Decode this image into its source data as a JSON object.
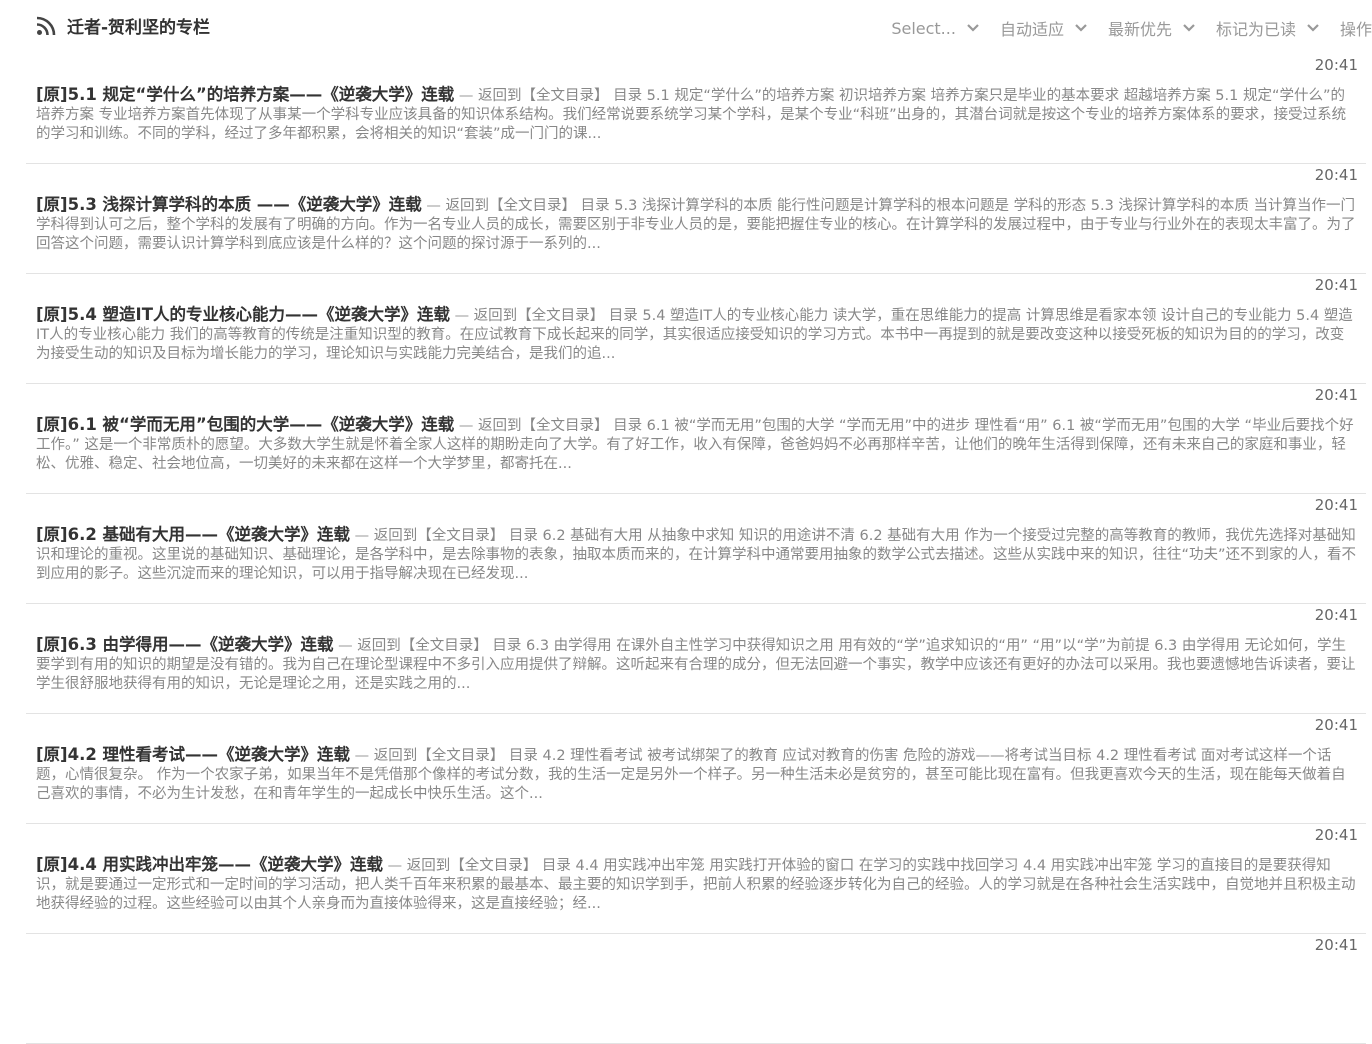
{
  "header": {
    "feed_name": "迁者-贺利坚的专栏",
    "feed_icon": "rss-icon",
    "controls": [
      {
        "label": "Select...",
        "icon": "chevron-down-icon"
      },
      {
        "label": "自动适应",
        "icon": "chevron-down-icon"
      },
      {
        "label": "最新优先",
        "icon": "chevron-down-icon"
      },
      {
        "label": "标记为已读",
        "icon": "chevron-down-icon"
      },
      {
        "label": "操作",
        "icon": "chevron-down-icon"
      }
    ]
  },
  "separator": "—",
  "articles": [
    {
      "time": "20:41",
      "title": "[原]5.1 规定“学什么”的培养方案——《逆袭大学》连载",
      "snippet": "返回到【全文目录】 目录 5.1 规定“学什么”的培养方案 初识培养方案 培养方案只是毕业的基本要求 超越培养方案 5.1 规定“学什么”的培养方案 专业培养方案首先体现了从事某一个学科专业应该具备的知识体系结构。我们经常说要系统学习某个学科，是某个专业“科班”出身的，其潜台词就是按这个专业的培养方案体系的要求，接受过系统的学习和训练。不同的学科，经过了多年都积累，会将相关的知识“套装”成一门门的课..."
    },
    {
      "time": "20:41",
      "title": "[原]5.3 浅探计算学科的本质 ——《逆袭大学》连载",
      "snippet": "返回到【全文目录】 目录 5.3 浅探计算学科的本质  能行性问题是计算学科的根本问题是 学科的形态 5.3 浅探计算学科的本质  当计算当作一门学科得到认可之后，整个学科的发展有了明确的方向。作为一名专业人员的成长，需要区别于非专业人员的是，要能把握住专业的核心。在计算学科的发展过程中，由于专业与行业外在的表现太丰富了。为了回答这个问题，需要认识计算学科到底应该是什么样的？这个问题的探讨源于一系列的..."
    },
    {
      "time": "20:41",
      "title": "[原]5.4 塑造IT人的专业核心能力——《逆袭大学》连载",
      "snippet": "返回到【全文目录】 目录 5.4 塑造IT人的专业核心能力 读大学，重在思维能力的提高 计算思维是看家本领 设计自己的专业能力 5.4 塑造IT人的专业核心能力 我们的高等教育的传统是注重知识型的教育。在应试教育下成长起来的同学，其实很适应接受知识的学习方式。本书中一再提到的就是要改变这种以接受死板的知识为目的的学习，改变为接受生动的知识及目标为增长能力的学习，理论知识与实践能力完美结合，是我们的追..."
    },
    {
      "time": "20:41",
      "title": "[原]6.1 被“学而无用”包围的大学——《逆袭大学》连载",
      "snippet": "返回到【全文目录】 目录 6.1 被“学而无用”包围的大学 “学而无用”中的进步 理性看“用” 6.1 被“学而无用”包围的大学 “毕业后要找个好工作。” 这是一个非常质朴的愿望。大多数大学生就是怀着全家人这样的期盼走向了大学。有了好工作，收入有保障，爸爸妈妈不必再那样辛苦，让他们的晚年生活得到保障，还有未来自己的家庭和事业，轻松、优雅、稳定、社会地位高，一切美好的未来都在这样一个大学梦里，都寄托在..."
    },
    {
      "time": "20:41",
      "title": "[原]6.2 基础有大用——《逆袭大学》连载",
      "snippet": "返回到【全文目录】 目录 6.2 基础有大用 从抽象中求知 知识的用途讲不清  6.2 基础有大用 作为一个接受过完整的高等教育的教师，我优先选择对基础知识和理论的重视。这里说的基础知识、基础理论，是各学科中，是去除事物的表象，抽取本质而来的，在计算学科中通常要用抽象的数学公式去描述。这些从实践中来的知识，往往“功夫”还不到家的人，看不到应用的影子。这些沉淀而来的理论知识，可以用于指导解决现在已经发现..."
    },
    {
      "time": "20:41",
      "title": "[原]6.3 由学得用——《逆袭大学》连载",
      "snippet": "返回到【全文目录】 目录 6.3 由学得用 在课外自主性学习中获得知识之用 用有效的“学”追求知识的“用” “用”以“学”为前提 6.3 由学得用 无论如何，学生要学到有用的知识的期望是没有错的。我为自己在理论型课程中不多引入应用提供了辩解。这听起来有合理的成分，但无法回避一个事实，教学中应该还有更好的办法可以采用。我也要遗憾地告诉读者，要让学生很舒服地获得有用的知识，无论是理论之用，还是实践之用的..."
    },
    {
      "time": "20:41",
      "title": "[原]4.2 理性看考试——《逆袭大学》连载",
      "snippet": "返回到【全文目录】 目录 4.2 理性看考试 被考试绑架了的教育 应试对教育的伤害 危险的游戏——将考试当目标 4.2 理性看考试 面对考试这样一个话题，心情很复杂。 作为一个农家子弟，如果当年不是凭借那个像样的考试分数，我的生活一定是另外一个样子。另一种生活未必是贫穷的，甚至可能比现在富有。但我更喜欢今天的生活，现在能每天做着自己喜欢的事情，不必为生计发愁，在和青年学生的一起成长中快乐生活。这个..."
    },
    {
      "time": "20:41",
      "title": "[原]4.4 用实践冲出牢笼——《逆袭大学》连载",
      "snippet": "返回到【全文目录】 目录 4.4 用实践冲出牢笼 用实践打开体验的窗口  在学习的实践中找回学习 4.4 用实践冲出牢笼 学习的直接目的是要获得知识，就是要通过一定形式和一定时间的学习活动，把人类千百年来积累的最基本、最主要的知识学到手，把前人积累的经验逐步转化为自己的经验。人的学习就是在各种社会生活实践中，自觉地并且积极主动地获得经验的过程。这些经验可以由其个人亲身而为直接体验得来，这是直接经验；经..."
    },
    {
      "time": "20:41",
      "title": "",
      "snippet": ""
    }
  ]
}
